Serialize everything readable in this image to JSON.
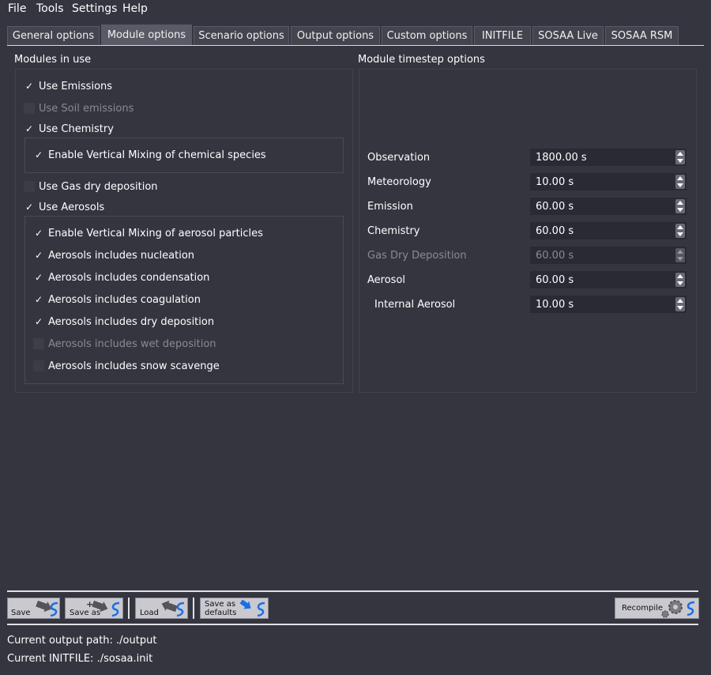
{
  "menu": [
    "File",
    "Tools",
    "Settings",
    "Help"
  ],
  "tabs": [
    "General options",
    "Module options",
    "Scenario options",
    "Output options",
    "Custom options",
    "INITFILE",
    "SOSAA Live",
    "SOSAA RSM"
  ],
  "active_tab": "Module options",
  "modules": {
    "title": "Modules in use",
    "use_emissions": {
      "label": "Use Emissions",
      "checked": true,
      "enabled": true
    },
    "use_soil_emissions": {
      "label": "Use Soil emissions",
      "checked": false,
      "enabled": false
    },
    "use_chemistry": {
      "label": "Use Chemistry",
      "checked": true,
      "enabled": true
    },
    "chem_vertical_mixing": {
      "label": "Enable Vertical Mixing of chemical species",
      "checked": true,
      "enabled": true
    },
    "use_gas_dry_deposition": {
      "label": "Use Gas dry deposition",
      "checked": false,
      "enabled": true
    },
    "use_aerosols": {
      "label": "Use Aerosols",
      "checked": true,
      "enabled": true
    },
    "aerosol_vertical_mixing": {
      "label": "Enable Vertical Mixing of aerosol particles",
      "checked": true,
      "enabled": true
    },
    "aerosol_nucleation": {
      "label": "Aerosols includes nucleation",
      "checked": true,
      "enabled": true
    },
    "aerosol_condensation": {
      "label": "Aerosols includes condensation",
      "checked": true,
      "enabled": true
    },
    "aerosol_coagulation": {
      "label": "Aerosols includes coagulation",
      "checked": true,
      "enabled": true
    },
    "aerosol_dry_deposition": {
      "label": "Aerosols includes dry deposition",
      "checked": true,
      "enabled": true
    },
    "aerosol_wet_deposition": {
      "label": "Aerosols includes wet deposition",
      "checked": false,
      "enabled": false
    },
    "aerosol_snow_scavenge": {
      "label": "Aerosols includes snow scavenge",
      "checked": false,
      "enabled": true
    }
  },
  "timesteps": {
    "title": "Module timestep options",
    "observation": {
      "label": "Observation",
      "value": "1800.00 s",
      "enabled": true
    },
    "meteorology": {
      "label": "Meteorology",
      "value": "10.00 s",
      "enabled": true
    },
    "emission": {
      "label": "Emission",
      "value": "60.00 s",
      "enabled": true
    },
    "chemistry": {
      "label": "Chemistry",
      "value": "60.00 s",
      "enabled": true
    },
    "gas_dry_deposition": {
      "label": "Gas Dry Deposition",
      "value": "60.00 s",
      "enabled": false
    },
    "aerosol": {
      "label": "Aerosol",
      "value": "60.00 s",
      "enabled": true
    },
    "internal_aerosol": {
      "label": "Internal Aerosol",
      "value": "10.00 s",
      "enabled": true
    }
  },
  "toolbar": {
    "save": "Save",
    "save_as": "Save as",
    "load": "Load",
    "save_as_defaults_line1": "Save as",
    "save_as_defaults_line2": "defaults",
    "recompile": "Recompile"
  },
  "status": {
    "output_path": "Current output path: ./output",
    "initfile": "Current INITFILE: ./sosaa.init"
  },
  "colors": {
    "background": "#353540",
    "accent_blue": "#1a6ee6",
    "button_face": "#c9c9cf"
  }
}
